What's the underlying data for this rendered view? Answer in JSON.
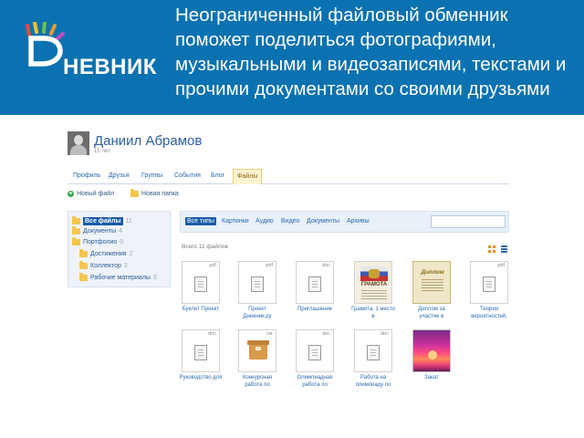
{
  "banner": {
    "logo_text": "НЕВНИК",
    "headline": "Неограниченный файловый обменник поможет поделиться фотографиями, музыкальными и видеозаписями, текстами и прочими документами со своими друзьями"
  },
  "profile": {
    "name": "Даниил Абрамов",
    "age": "15 лет"
  },
  "tabs": [
    "Профиль",
    "Друзья",
    "Группы",
    "События",
    "Блог",
    "Файлы"
  ],
  "active_tab": "Файлы",
  "actions": {
    "new_file": "Новый файл",
    "new_folder": "Новая папка"
  },
  "sidebar": {
    "items": [
      {
        "label": "Все файлы",
        "count": "11"
      },
      {
        "label": "Документы",
        "count": "4"
      },
      {
        "label": "Портфолио",
        "count": "0"
      },
      {
        "label": "Достижения",
        "count": "2"
      },
      {
        "label": "Коллектор",
        "count": "2"
      },
      {
        "label": "Рабочие материалы",
        "count": "3"
      }
    ]
  },
  "file_types": [
    "Все типы",
    "Картинки",
    "Аудио",
    "Видео",
    "Документы",
    "Архивы"
  ],
  "files_count": "Всего 11 файлов",
  "files": [
    {
      "name": "Буклет Проект",
      "ext": "pdf"
    },
    {
      "name": "Проект Дневник.ру",
      "ext": "pdf"
    },
    {
      "name": "Приглашение",
      "ext": "doc"
    },
    {
      "name": "Грамота, 1 место в",
      "ext": "",
      "thumb_title": "ГРАМОТА"
    },
    {
      "name": "Диплом за участие в",
      "ext": "",
      "thumb_title": "Диплом"
    },
    {
      "name": "Теория вероятностей,",
      "ext": "pdf"
    },
    {
      "name": "Руководство для",
      "ext": "doc"
    },
    {
      "name": "Конкурсная работа по",
      "ext": "rar"
    },
    {
      "name": "Олимпиадная работа по",
      "ext": "doc"
    },
    {
      "name": "Работа на олимпиаду по",
      "ext": "doc"
    },
    {
      "name": "Закат",
      "ext": ""
    }
  ],
  "colors": {
    "banner": "#0a72b1",
    "link": "#2d6bb0",
    "active_tab_bg": "#fff3cf",
    "active_filter": "#1a5ca8"
  }
}
